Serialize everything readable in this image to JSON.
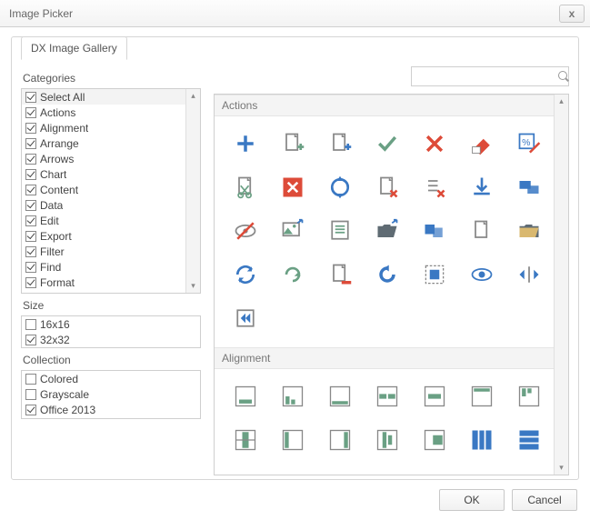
{
  "window": {
    "title": "Image Picker"
  },
  "tab": {
    "label": "DX Image Gallery"
  },
  "search": {
    "placeholder": ""
  },
  "categories": {
    "label": "Categories",
    "items": [
      {
        "label": "Select All",
        "checked": true,
        "selected": true
      },
      {
        "label": "Actions",
        "checked": true
      },
      {
        "label": "Alignment",
        "checked": true
      },
      {
        "label": "Arrange",
        "checked": true
      },
      {
        "label": "Arrows",
        "checked": true
      },
      {
        "label": "Chart",
        "checked": true
      },
      {
        "label": "Content",
        "checked": true
      },
      {
        "label": "Data",
        "checked": true
      },
      {
        "label": "Edit",
        "checked": true
      },
      {
        "label": "Export",
        "checked": true
      },
      {
        "label": "Filter",
        "checked": true
      },
      {
        "label": "Find",
        "checked": true
      },
      {
        "label": "Format",
        "checked": true
      }
    ]
  },
  "size": {
    "label": "Size",
    "items": [
      {
        "label": "16x16",
        "checked": false
      },
      {
        "label": "32x32",
        "checked": true
      }
    ]
  },
  "collection": {
    "label": "Collection",
    "items": [
      {
        "label": "Colored",
        "checked": false
      },
      {
        "label": "Grayscale",
        "checked": false
      },
      {
        "label": "Office 2013",
        "checked": true
      }
    ]
  },
  "groups": {
    "actions": "Actions",
    "alignment": "Alignment"
  },
  "buttons": {
    "ok": "OK",
    "cancel": "Cancel"
  },
  "palette": {
    "blue": "#3a78c3",
    "green": "#6aa084",
    "red": "#dd4b39",
    "gray": "#888888",
    "dgray": "#5f6b73"
  }
}
